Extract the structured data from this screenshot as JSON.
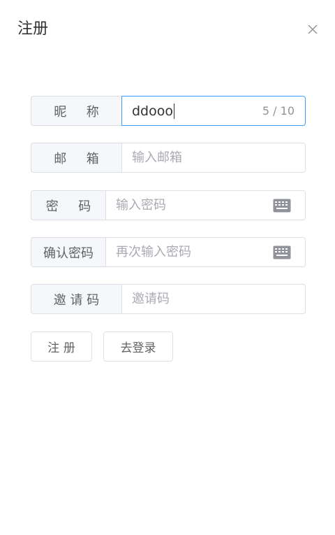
{
  "dialog": {
    "title": "注册",
    "close_icon": "close-icon"
  },
  "form": {
    "nickname": {
      "label": "昵     称",
      "value": "ddooo",
      "counter": "5 / 10"
    },
    "email": {
      "label": "邮     箱",
      "placeholder": "输入邮箱"
    },
    "password": {
      "label": "密     码",
      "placeholder": "输入密码",
      "icon": "keyboard-icon"
    },
    "confirm_password": {
      "label": "确认密码",
      "placeholder": "再次输入密码",
      "icon": "keyboard-icon"
    },
    "invite_code": {
      "label": "邀 请 码",
      "placeholder": "邀请码"
    }
  },
  "actions": {
    "register_label": "注 册",
    "to_login_label": "去登录"
  },
  "colors": {
    "focus_border": "#409eff",
    "border": "#dcdfe6",
    "prepend_bg": "#f5f7fa"
  }
}
